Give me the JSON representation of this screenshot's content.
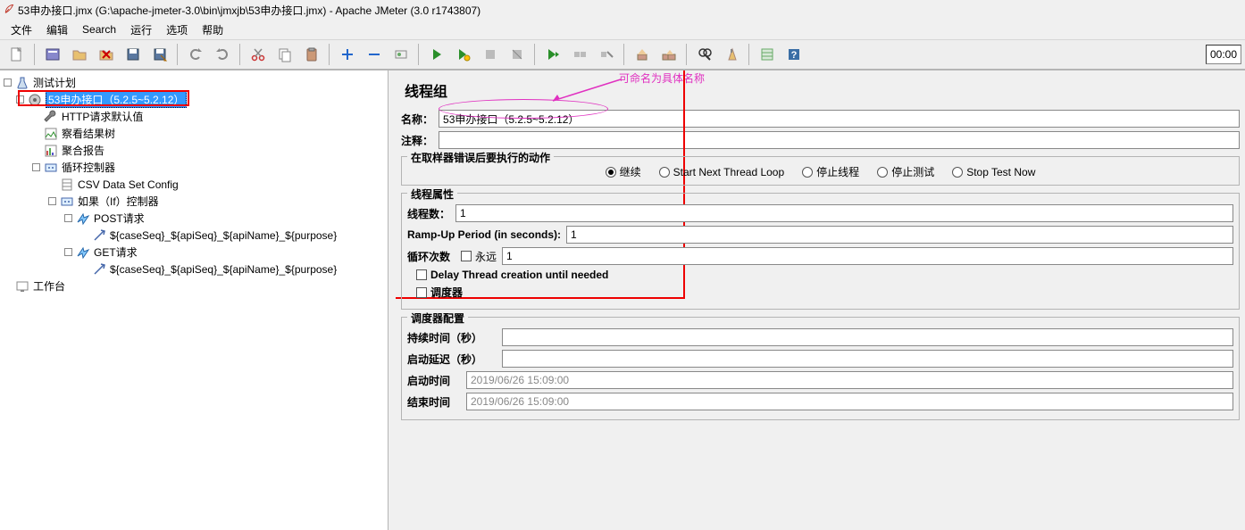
{
  "titlebar": {
    "text": "53申办接口.jmx (G:\\apache-jmeter-3.0\\bin\\jmxjb\\53申办接口.jmx) - Apache JMeter (3.0 r1743807)"
  },
  "menu": {
    "items": [
      "文件",
      "编辑",
      "Search",
      "运行",
      "选项",
      "帮助"
    ]
  },
  "toolbar": {
    "time": "00:00"
  },
  "tree": {
    "root": "测试计划",
    "thread_group": "53申办接口（5.2.5~5.2.12）",
    "http_defaults": "HTTP请求默认值",
    "view_results": "察看结果树",
    "aggregate": "聚合报告",
    "loop_ctrl": "循环控制器",
    "csv": "CSV Data Set Config",
    "if_ctrl": "如果（If）控制器",
    "post": "POST请求",
    "param_expr_1": "${caseSeq}_${apiSeq}_${apiName}_${purpose}",
    "get": "GET请求",
    "param_expr_2": "${caseSeq}_${apiSeq}_${apiName}_${purpose}",
    "workbench": "工作台"
  },
  "annotation": {
    "rename_hint": "可命名为具体名称"
  },
  "form": {
    "panel_title": "线程组",
    "name_label": "名称：",
    "name_value": "53申办接口（5.2.5~5.2.12）",
    "comment_label": "注释：",
    "comment_value": "",
    "on_error_group": "在取样器错误后要执行的动作",
    "on_error_options": [
      "继续",
      "Start Next Thread Loop",
      "停止线程",
      "停止测试",
      "Stop Test Now"
    ],
    "thread_props_group": "线程属性",
    "threads_label": "线程数：",
    "threads_value": "1",
    "rampup_label": "Ramp-Up Period (in seconds):",
    "rampup_value": "1",
    "loop_label": "循环次数",
    "loop_forever_label": "永远",
    "loop_value": "1",
    "delay_create_label": "Delay Thread creation until needed",
    "scheduler_label": "调度器",
    "scheduler_group": "调度器配置",
    "duration_label": "持续时间（秒）",
    "duration_value": "",
    "startup_delay_label": "启动延迟（秒）",
    "startup_delay_value": "",
    "start_time_label": "启动时间",
    "start_time_value": "2019/06/26 15:09:00",
    "end_time_label": "结束时间",
    "end_time_value": "2019/06/26 15:09:00"
  }
}
